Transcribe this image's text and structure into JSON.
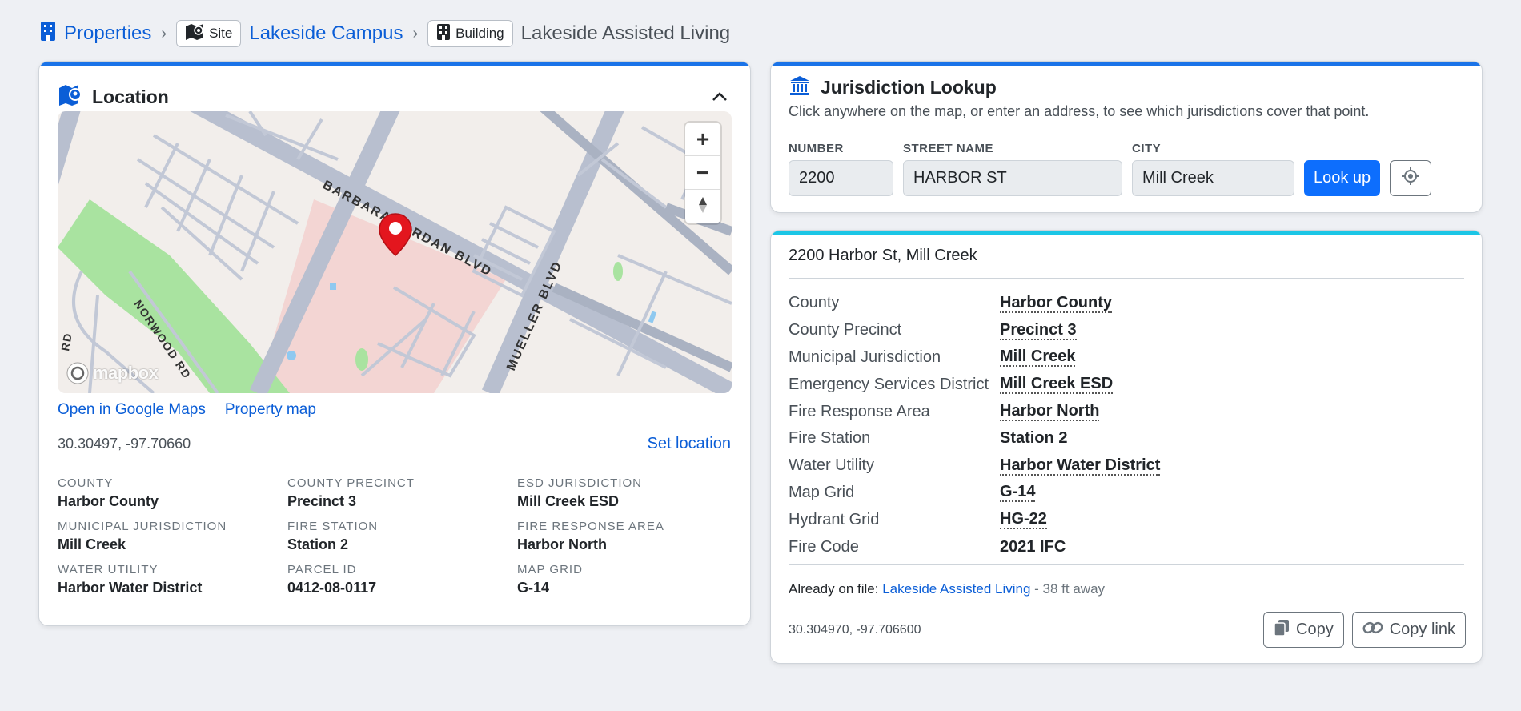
{
  "breadcrumb": {
    "root_label": "Properties",
    "site_badge": "Site",
    "site_label": "Lakeside Campus",
    "building_badge": "Building",
    "current_label": "Lakeside Assisted Living"
  },
  "location": {
    "title": "Location",
    "map": {
      "street_labels": [
        "BARBARA JORDAN BLVD",
        "MUELLER BLVD",
        "NORWOOD RD",
        "RD"
      ],
      "zoom_in": "+",
      "zoom_out": "−",
      "provider_logo": "mapbox"
    },
    "links": {
      "google_maps": "Open in Google Maps",
      "property_map": "Property map"
    },
    "coordinates": "30.30497, -97.70660",
    "set_location": "Set location",
    "attributes": [
      {
        "label": "County",
        "value": "Harbor County"
      },
      {
        "label": "County Precinct",
        "value": "Precinct 3"
      },
      {
        "label": "ESD Jurisdiction",
        "value": "Mill Creek ESD"
      },
      {
        "label": "Municipal Jurisdiction",
        "value": "Mill Creek"
      },
      {
        "label": "Fire Station",
        "value": "Station 2"
      },
      {
        "label": "Fire Response Area",
        "value": "Harbor North"
      },
      {
        "label": "Water Utility",
        "value": "Harbor Water District"
      },
      {
        "label": "Parcel ID",
        "value": "0412-08-0117"
      },
      {
        "label": "Map Grid",
        "value": "G-14"
      }
    ]
  },
  "lookup": {
    "title": "Jurisdiction Lookup",
    "subtitle": "Click anywhere on the map, or enter an address, to see which jurisdictions cover that point.",
    "fields": {
      "number_label": "NUMBER",
      "number_value": "2200",
      "street_label": "STREET NAME",
      "street_value": "HARBOR ST",
      "city_label": "CITY",
      "city_value": "Mill Creek"
    },
    "lookup_button": "Look up"
  },
  "result": {
    "address": "2200 Harbor St, Mill Creek",
    "rows": [
      {
        "key": "County",
        "value": "Harbor County",
        "linked": true
      },
      {
        "key": "County Precinct",
        "value": "Precinct 3",
        "linked": true
      },
      {
        "key": "Municipal Jurisdiction",
        "value": "Mill Creek",
        "linked": true
      },
      {
        "key": "Emergency Services District",
        "value": "Mill Creek ESD",
        "linked": true
      },
      {
        "key": "Fire Response Area",
        "value": "Harbor North",
        "linked": true
      },
      {
        "key": "Fire Station",
        "value": "Station 2",
        "linked": false
      },
      {
        "key": "Water Utility",
        "value": "Harbor Water District",
        "linked": true
      },
      {
        "key": "Map Grid",
        "value": "G-14",
        "linked": true
      },
      {
        "key": "Hydrant Grid",
        "value": "HG-22",
        "linked": true
      },
      {
        "key": "Fire Code",
        "value": "2021 IFC",
        "linked": false
      }
    ],
    "on_file_prefix": "Already on file:",
    "on_file_link": "Lakeside Assisted Living",
    "on_file_distance": "- 38 ft away",
    "coordinates": "30.304970, -97.706600",
    "copy_button": "Copy",
    "copy_link_button": "Copy link"
  }
}
